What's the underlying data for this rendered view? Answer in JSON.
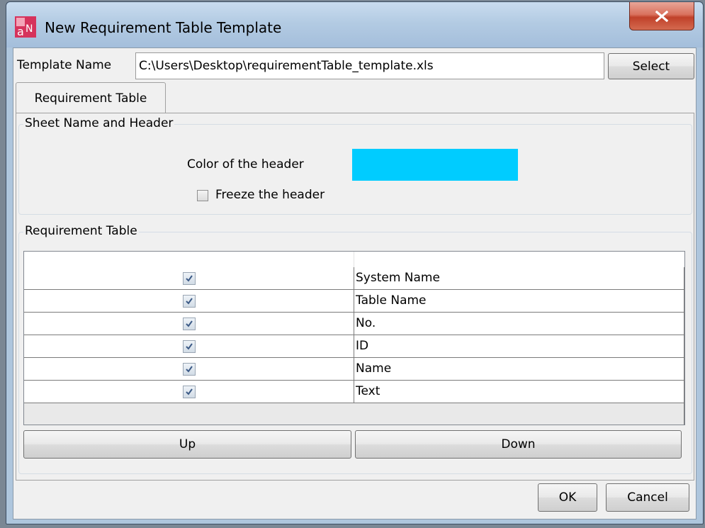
{
  "window": {
    "title": "New Requirement Table Template",
    "icon": "app-icon",
    "close_icon": "close-icon"
  },
  "template": {
    "label": "Template Name",
    "value": "C:\\Users\\Desktop\\requirementTable_template.xls",
    "select_label": "Select"
  },
  "tabs": [
    {
      "label": "Requirement Table"
    }
  ],
  "sheet_group": {
    "title": "Sheet Name and Header",
    "color_label": "Color of the header",
    "header_color": "#00ccff",
    "freeze_label": "Freeze the header",
    "freeze_checked": false
  },
  "table_group": {
    "title": "Requirement Table",
    "rows": [
      {
        "checked": true,
        "name": "System Name"
      },
      {
        "checked": true,
        "name": "Table Name"
      },
      {
        "checked": true,
        "name": "No."
      },
      {
        "checked": true,
        "name": "ID"
      },
      {
        "checked": true,
        "name": "Name"
      },
      {
        "checked": true,
        "name": "Text"
      }
    ],
    "up_label": "Up",
    "down_label": "Down"
  },
  "footer": {
    "ok_label": "OK",
    "cancel_label": "Cancel"
  }
}
